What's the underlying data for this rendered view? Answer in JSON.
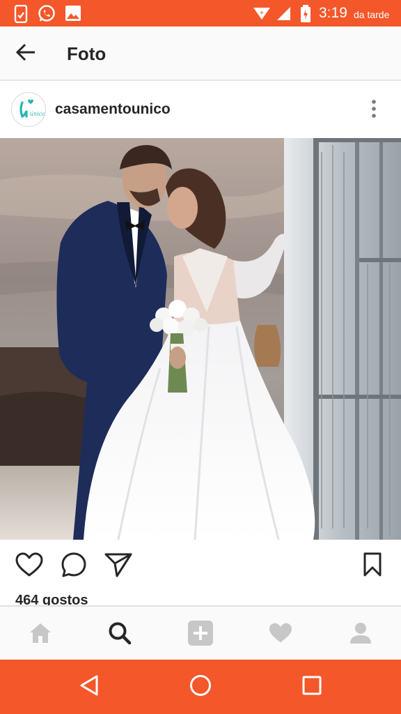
{
  "status_bar": {
    "time": "3:19",
    "time_suffix": "da tarde",
    "icons": [
      "battery-saver-icon",
      "whatsapp-icon",
      "image-icon",
      "data-saver-icon",
      "signal-icon",
      "battery-charging-icon"
    ]
  },
  "app_bar": {
    "back_icon": "arrow-left-icon",
    "title": "Foto"
  },
  "post": {
    "username": "casamentounico",
    "avatar_text": "único",
    "more_icon": "more-vertical-icon",
    "image_description_icon": "wedding-photo",
    "likes": "464 gostos"
  },
  "actions": {
    "icons": [
      "heart-icon",
      "comment-icon",
      "share-icon",
      "bookmark-icon"
    ]
  },
  "bottom_nav": {
    "icons": [
      "home-icon",
      "search-icon",
      "add-icon",
      "activity-heart-icon",
      "profile-icon"
    ],
    "active": "search-icon"
  },
  "system_nav": {
    "icons": [
      "back-triangle-icon",
      "home-circle-icon",
      "recents-square-icon"
    ]
  },
  "colors": {
    "accent": "#f4572a",
    "text": "#262626",
    "inactive": "#c7c7c7",
    "avatar_teal": "#27b5b0"
  }
}
